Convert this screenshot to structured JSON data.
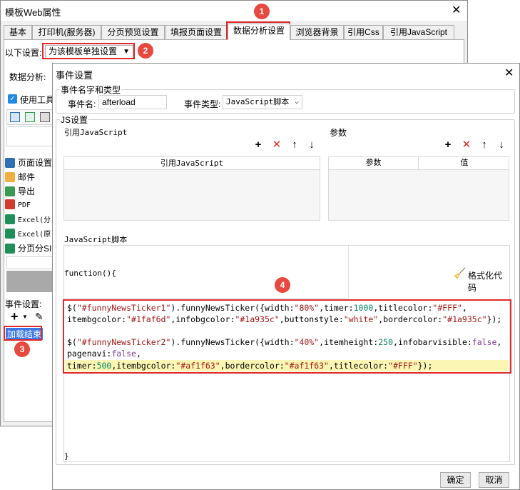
{
  "bg_window": {
    "title": "模板Web属性",
    "tabs": [
      "基本",
      "打印机(服务器)",
      "分页预览设置",
      "填报页面设置",
      "数据分析设置",
      "浏览器背景",
      "引用Css",
      "引用JavaScript"
    ],
    "settings_label": "以下设置:",
    "settings_value": "为该模板单独设置",
    "data_analysis_label": "数据分析:",
    "use_toolbar_label": "使用工具",
    "toolbar_items": [
      "页面设置",
      "邮件",
      "导出",
      "PDF",
      "Excel(分",
      "Excel(原",
      "分页分SI"
    ],
    "event_settings_label": "事件设置:",
    "event_item": "加载结束"
  },
  "badges": [
    "1",
    "2",
    "3",
    "4"
  ],
  "dialog": {
    "title": "事件设置",
    "name_group_label": "事件名字和类型",
    "event_name_label": "事件名:",
    "event_name_value": "afterload",
    "event_type_label": "事件类型:",
    "event_type_value": "JavaScript脚本",
    "js_group_label": "JS设置",
    "ref_js_label": "引用JavaScript",
    "ref_js_col": "引用JavaScript",
    "params_label": "参数",
    "params_col_name": "参数",
    "params_col_value": "值",
    "script_label": "JavaScript脚本",
    "format_code_label": "格式化代码",
    "function_open": "function(){",
    "function_close": "}",
    "ok_label": "确定",
    "cancel_label": "取消"
  },
  "code": {
    "l1": {
      "a": "$(",
      "b": "\"#funnyNewsTicker1\"",
      "c": ").funnyNewsTicker({width:",
      "d": "\"80%\"",
      "e": ",timer:",
      "f": "1000",
      "g": ",titlecolor:",
      "h": "\"#FFF\"",
      "i": ","
    },
    "l2": {
      "a": "itembgcolor:",
      "b": "\"#1faf6d\"",
      "c": ",infobgcolor:",
      "d": "\"#1a935c\"",
      "e": ",buttonstyle:",
      "f": "\"white\"",
      "g": ",bordercolor:",
      "h": "\"#1a935c\"",
      "i": "});"
    },
    "l3": {
      "a": "$(",
      "b": "\"#funnyNewsTicker2\"",
      "c": ").funnyNewsTicker({width:",
      "d": "\"40%\"",
      "e": ",itemheight:",
      "f": "250",
      "g": ",infobarvisible:",
      "h": "false",
      "i": ","
    },
    "l4": {
      "a": "pagenavi:",
      "b": "false",
      "c": ","
    },
    "l5": {
      "a": "timer:",
      "b": "500",
      "c": ",itembgcolor:",
      "d": "\"#af1f63\"",
      "e": ",bordercolor:",
      "f": "\"#af1f63\"",
      "g": ",titlecolor:",
      "h": "\"#FFF\"",
      "i": "});"
    }
  },
  "colors": {
    "accent_red": "#e02a2a",
    "badge_red": "#e8493f",
    "selection_blue": "#3b78e7",
    "highlight_yellow": "#fbf6b4"
  }
}
